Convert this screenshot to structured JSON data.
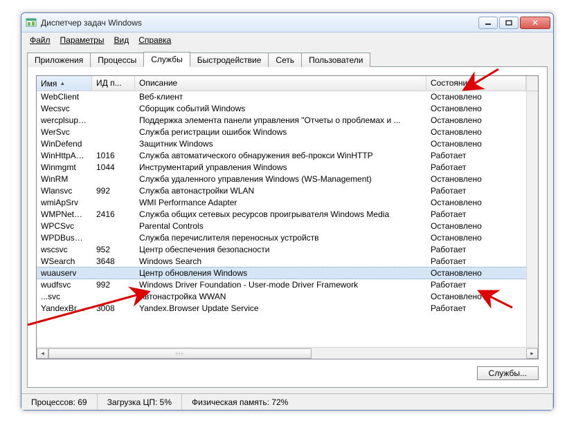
{
  "window": {
    "title": "Диспетчер задач Windows"
  },
  "menu": {
    "file": "Файл",
    "options": "Параметры",
    "view": "Вид",
    "help": "Справка"
  },
  "tabs": {
    "apps": "Приложения",
    "processes": "Процессы",
    "services": "Службы",
    "performance": "Быстродействие",
    "network": "Сеть",
    "users": "Пользователи"
  },
  "columns": {
    "name": "Имя",
    "pid": "ИД п...",
    "desc": "Описание",
    "state": "Состояние"
  },
  "rows": [
    {
      "name": "WebClient",
      "pid": "",
      "desc": "Веб-клиент",
      "state": "Остановлено"
    },
    {
      "name": "Wecsvc",
      "pid": "",
      "desc": "Сборщик событий Windows",
      "state": "Остановлено"
    },
    {
      "name": "wercplsupport",
      "pid": "",
      "desc": "Поддержка элемента панели управления \"Отчеты о проблемах и ...",
      "state": "Остановлено"
    },
    {
      "name": "WerSvc",
      "pid": "",
      "desc": "Служба регистрации ошибок Windows",
      "state": "Остановлено"
    },
    {
      "name": "WinDefend",
      "pid": "",
      "desc": "Защитник Windows",
      "state": "Остановлено"
    },
    {
      "name": "WinHttpAut...",
      "pid": "1016",
      "desc": "Служба автоматического обнаружения веб-прокси WinHTTP",
      "state": "Работает"
    },
    {
      "name": "Winmgmt",
      "pid": "1044",
      "desc": "Инструментарий управления Windows",
      "state": "Работает"
    },
    {
      "name": "WinRM",
      "pid": "",
      "desc": "Служба удаленного управления Windows (WS-Management)",
      "state": "Остановлено"
    },
    {
      "name": "Wlansvc",
      "pid": "992",
      "desc": "Служба автонастройки WLAN",
      "state": "Работает"
    },
    {
      "name": "wmiApSrv",
      "pid": "",
      "desc": "WMI Performance Adapter",
      "state": "Остановлено"
    },
    {
      "name": "WMPNetwo...",
      "pid": "2416",
      "desc": "Служба общих сетевых ресурсов проигрывателя Windows Media",
      "state": "Работает"
    },
    {
      "name": "WPCSvc",
      "pid": "",
      "desc": "Parental Controls",
      "state": "Остановлено"
    },
    {
      "name": "WPDBusEnum",
      "pid": "",
      "desc": "Служба перечислителя переносных устройств",
      "state": "Остановлено"
    },
    {
      "name": "wscsvc",
      "pid": "952",
      "desc": "Центр обеспечения безопасности",
      "state": "Работает"
    },
    {
      "name": "WSearch",
      "pid": "3648",
      "desc": "Windows Search",
      "state": "Работает"
    },
    {
      "name": "wuauserv",
      "pid": "",
      "desc": "Центр обновления Windows",
      "state": "Остановлено",
      "selected": true
    },
    {
      "name": "wudfsvc",
      "pid": "992",
      "desc": "Windows Driver Foundation - User-mode Driver Framework",
      "state": "Работает"
    },
    {
      "name": "...svc",
      "pid": "",
      "desc": "Автонастройка WWAN",
      "state": "Остановлено"
    },
    {
      "name": "YandexBro...",
      "pid": "3008",
      "desc": "Yandex.Browser Update Service",
      "state": "Работает"
    }
  ],
  "buttons": {
    "services": "Службы..."
  },
  "status": {
    "processes": "Процессов: 69",
    "cpu": "Загрузка ЦП: 5%",
    "mem": "Физическая память: 72%"
  }
}
